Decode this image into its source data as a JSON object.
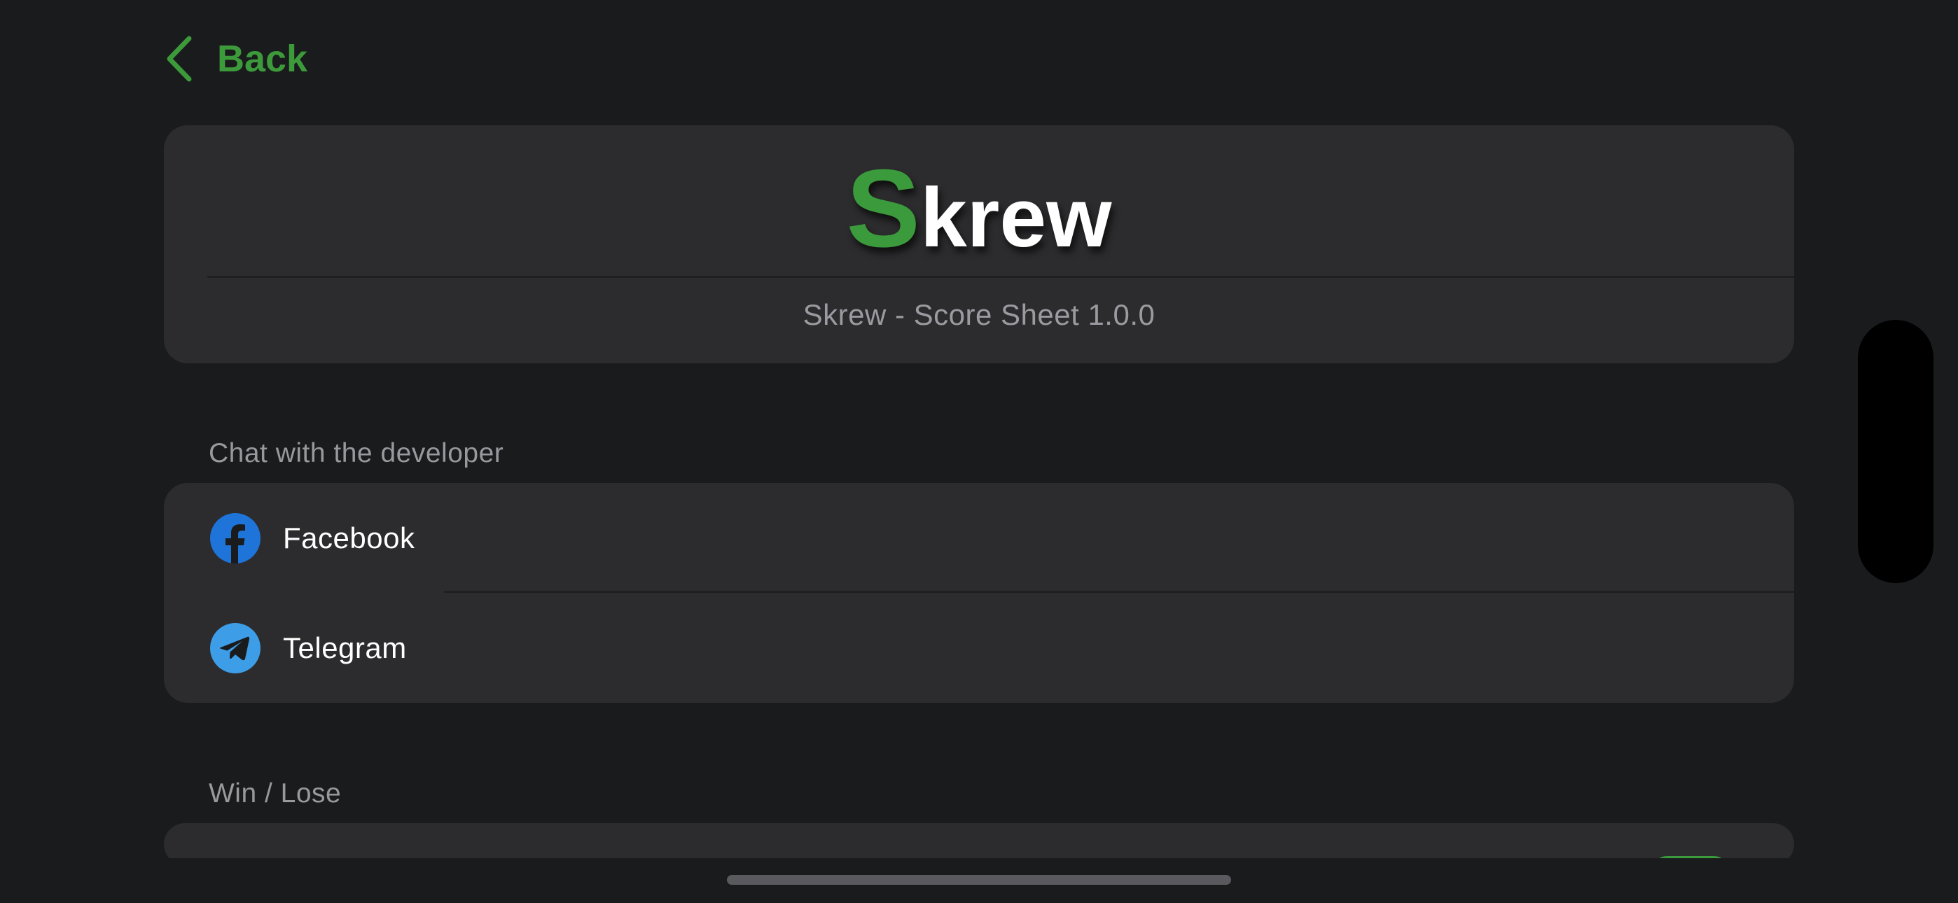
{
  "nav": {
    "back_label": "Back"
  },
  "header": {
    "logo_initial": "S",
    "logo_rest": "krew",
    "version": "Skrew - Score Sheet 1.0.0"
  },
  "sections": {
    "chat": {
      "title": "Chat with the developer",
      "items": [
        {
          "label": "Facebook",
          "icon": "facebook-icon"
        },
        {
          "label": "Telegram",
          "icon": "telegram-icon"
        }
      ]
    },
    "win_lose": {
      "title": "Win / Lose"
    }
  },
  "colors": {
    "accent_green": "#3b9a3b",
    "background": "#1a1b1d",
    "card": "#2c2c2e",
    "facebook_blue": "#1f74d9",
    "telegram_blue": "#3d9de7"
  }
}
